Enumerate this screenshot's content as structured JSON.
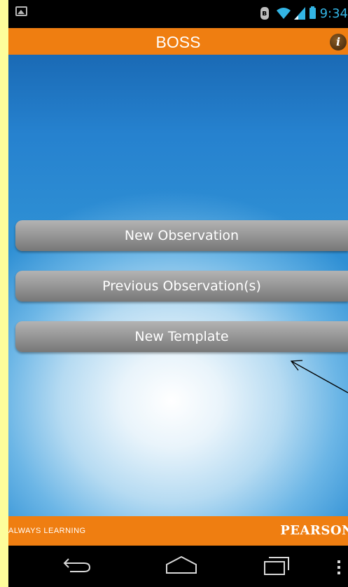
{
  "status_bar": {
    "time": "9:34",
    "icons": [
      "image-icon",
      "bluetooth-icon",
      "wifi-icon",
      "signal-icon",
      "battery-icon"
    ],
    "bluetooth_glyph": "ʙ"
  },
  "app_bar": {
    "title": "BOSS",
    "info_glyph": "i",
    "accent_color": "#ef7e11"
  },
  "menu": {
    "new_observation": "New Observation",
    "previous_observations": "Previous Observation(s)",
    "new_template": "New Template"
  },
  "footer": {
    "tagline": "ALWAYS LEARNING",
    "brand": "PEARSON"
  },
  "nav_bar": {
    "icons": [
      "back-icon",
      "home-icon",
      "recent-apps-icon",
      "overflow-menu-icon"
    ]
  }
}
